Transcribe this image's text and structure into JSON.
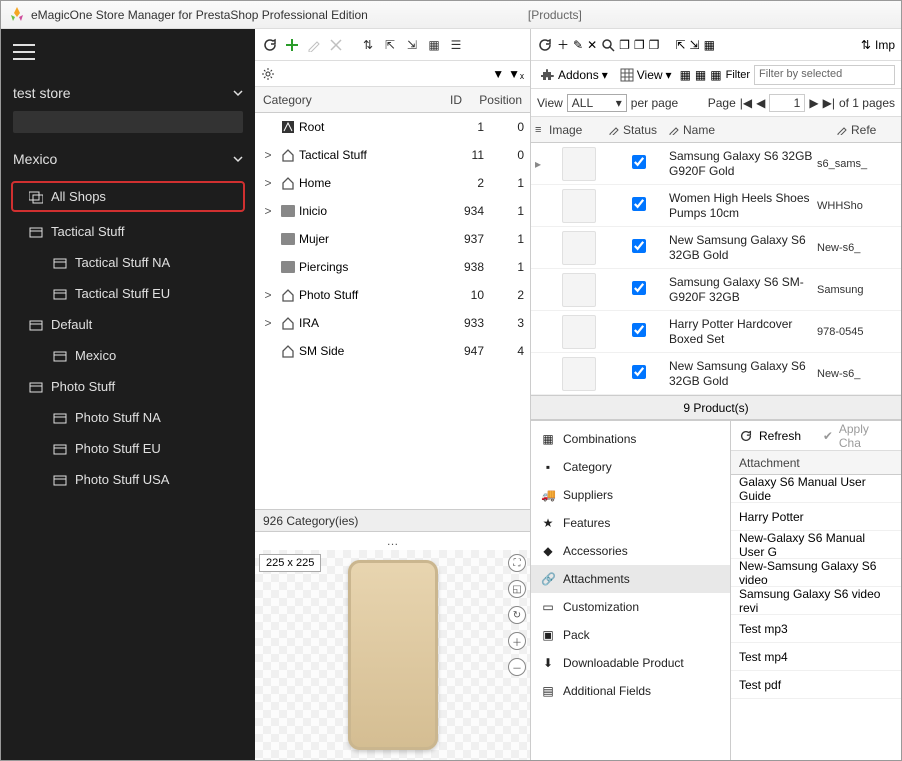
{
  "window": {
    "title": "eMagicOne Store Manager for PrestaShop Professional Edition",
    "section": "[Products]"
  },
  "sidebar": {
    "store_name": "test store",
    "location": "Mexico",
    "all_shops": "All Shops",
    "tree": [
      {
        "label": "Tactical Stuff",
        "children": [
          "Tactical Stuff NA",
          "Tactical Stuff EU"
        ]
      },
      {
        "label": "Default",
        "children": [
          "Mexico"
        ]
      },
      {
        "label": "Photo Stuff",
        "children": [
          "Photo Stuff NA",
          "Photo Stuff EU",
          "Photo Stuff USA"
        ]
      }
    ]
  },
  "categories": {
    "headers": {
      "cat": "Category",
      "id": "ID",
      "pos": "Position"
    },
    "rows": [
      {
        "expand": "",
        "icon": "root",
        "name": "Root",
        "id": 1,
        "pos": 0
      },
      {
        "expand": ">",
        "icon": "home",
        "name": "Tactical Stuff",
        "id": 11,
        "pos": 0
      },
      {
        "expand": ">",
        "icon": "home",
        "name": "Home",
        "id": 2,
        "pos": 1
      },
      {
        "expand": ">",
        "icon": "folder",
        "name": "Inicio",
        "id": 934,
        "pos": 1
      },
      {
        "expand": "",
        "icon": "folder",
        "name": "Mujer",
        "id": 937,
        "pos": 1
      },
      {
        "expand": "",
        "icon": "folder",
        "name": "Piercings",
        "id": 938,
        "pos": 1
      },
      {
        "expand": ">",
        "icon": "home",
        "name": "Photo Stuff",
        "id": 10,
        "pos": 2
      },
      {
        "expand": ">",
        "icon": "home",
        "name": "IRA",
        "id": 933,
        "pos": 3
      },
      {
        "expand": "",
        "icon": "home",
        "name": "SM Side",
        "id": 947,
        "pos": 4
      }
    ],
    "footer": "926 Category(ies)",
    "preview_size": "225 x 225"
  },
  "products_toolbar": {
    "addons": "Addons",
    "view": "View",
    "filter_label": "Filter",
    "filter_value": "Filter by selected",
    "view_label": "View",
    "perpage_sel": "ALL",
    "perpage_label": "per page",
    "page_label": "Page",
    "page_value": "1",
    "page_total": "of 1 pages"
  },
  "products": {
    "headers": {
      "image": "Image",
      "status": "Status",
      "name": "Name",
      "ref": "Refe"
    },
    "rows": [
      {
        "name": "Samsung Galaxy S6 32GB G920F Gold",
        "ref": "s6_sams_"
      },
      {
        "name": "Women High Heels Shoes Pumps 10cm",
        "ref": "WHHSho"
      },
      {
        "name": "New Samsung Galaxy S6 32GB Gold",
        "ref": "New-s6_"
      },
      {
        "name": "Samsung Galaxy S6 SM-G920F 32GB",
        "ref": "Samsung"
      },
      {
        "name": "Harry Potter Hardcover Boxed Set",
        "ref": "978-0545"
      },
      {
        "name": "New Samsung Galaxy S6 32GB Gold",
        "ref": "New-s6_"
      }
    ],
    "footer": "9 Product(s)"
  },
  "detail_tabs": [
    "Combinations",
    "Category",
    "Suppliers",
    "Features",
    "Accessories",
    "Attachments",
    "Customization",
    "Pack",
    "Downloadable Product",
    "Additional Fields"
  ],
  "attachments": {
    "refresh": "Refresh",
    "apply": "Apply Cha",
    "header": "Attachment",
    "rows": [
      "Galaxy S6 Manual User Guide",
      "Harry Potter",
      "New-Galaxy S6 Manual User G",
      "New-Samsung Galaxy S6 video",
      "Samsung Galaxy S6 video revi",
      "Test mp3",
      "Test mp4",
      "Test pdf"
    ]
  },
  "import_label": "Imp"
}
